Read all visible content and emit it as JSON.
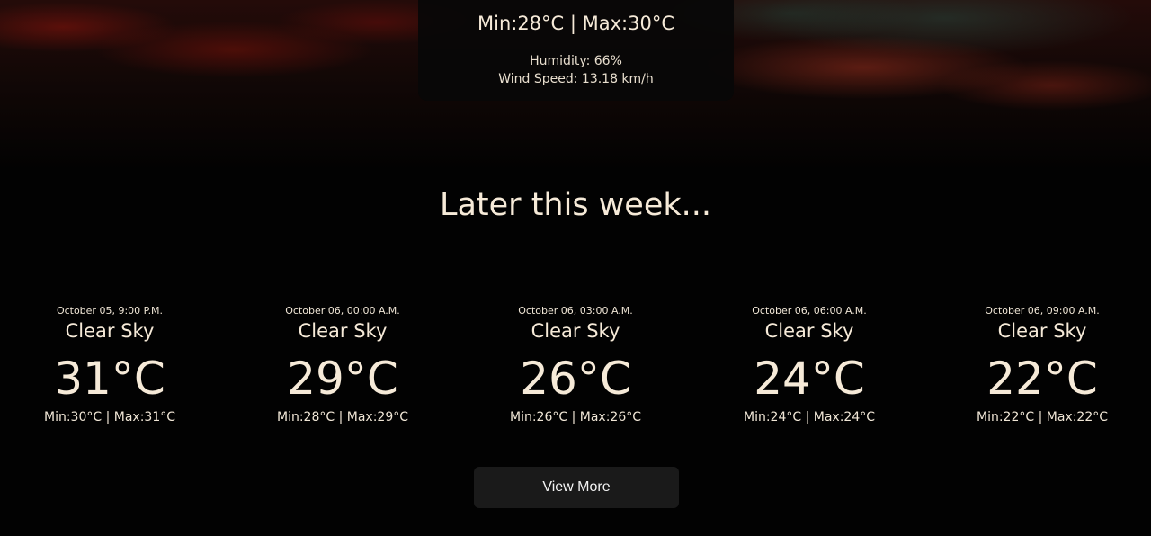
{
  "current": {
    "minmax": "Min:28°C | Max:30°C",
    "humidity": "Humidity: 66%",
    "wind_speed": "Wind Speed: 13.18 km/h"
  },
  "later": {
    "title": "Later this week..."
  },
  "forecast": [
    {
      "date": "October 05, 9:00 P.M.",
      "condition": "Clear Sky",
      "temp": "31°C",
      "minmax": "Min:30°C | Max:31°C"
    },
    {
      "date": "October 06, 00:00 A.M.",
      "condition": "Clear Sky",
      "temp": "29°C",
      "minmax": "Min:28°C | Max:29°C"
    },
    {
      "date": "October 06, 03:00 A.M.",
      "condition": "Clear Sky",
      "temp": "26°C",
      "minmax": "Min:26°C | Max:26°C"
    },
    {
      "date": "October 06, 06:00 A.M.",
      "condition": "Clear Sky",
      "temp": "24°C",
      "minmax": "Min:24°C | Max:24°C"
    },
    {
      "date": "October 06, 09:00 A.M.",
      "condition": "Clear Sky",
      "temp": "22°C",
      "minmax": "Min:22°C | Max:22°C"
    }
  ],
  "actions": {
    "view_more_label": "View More"
  }
}
